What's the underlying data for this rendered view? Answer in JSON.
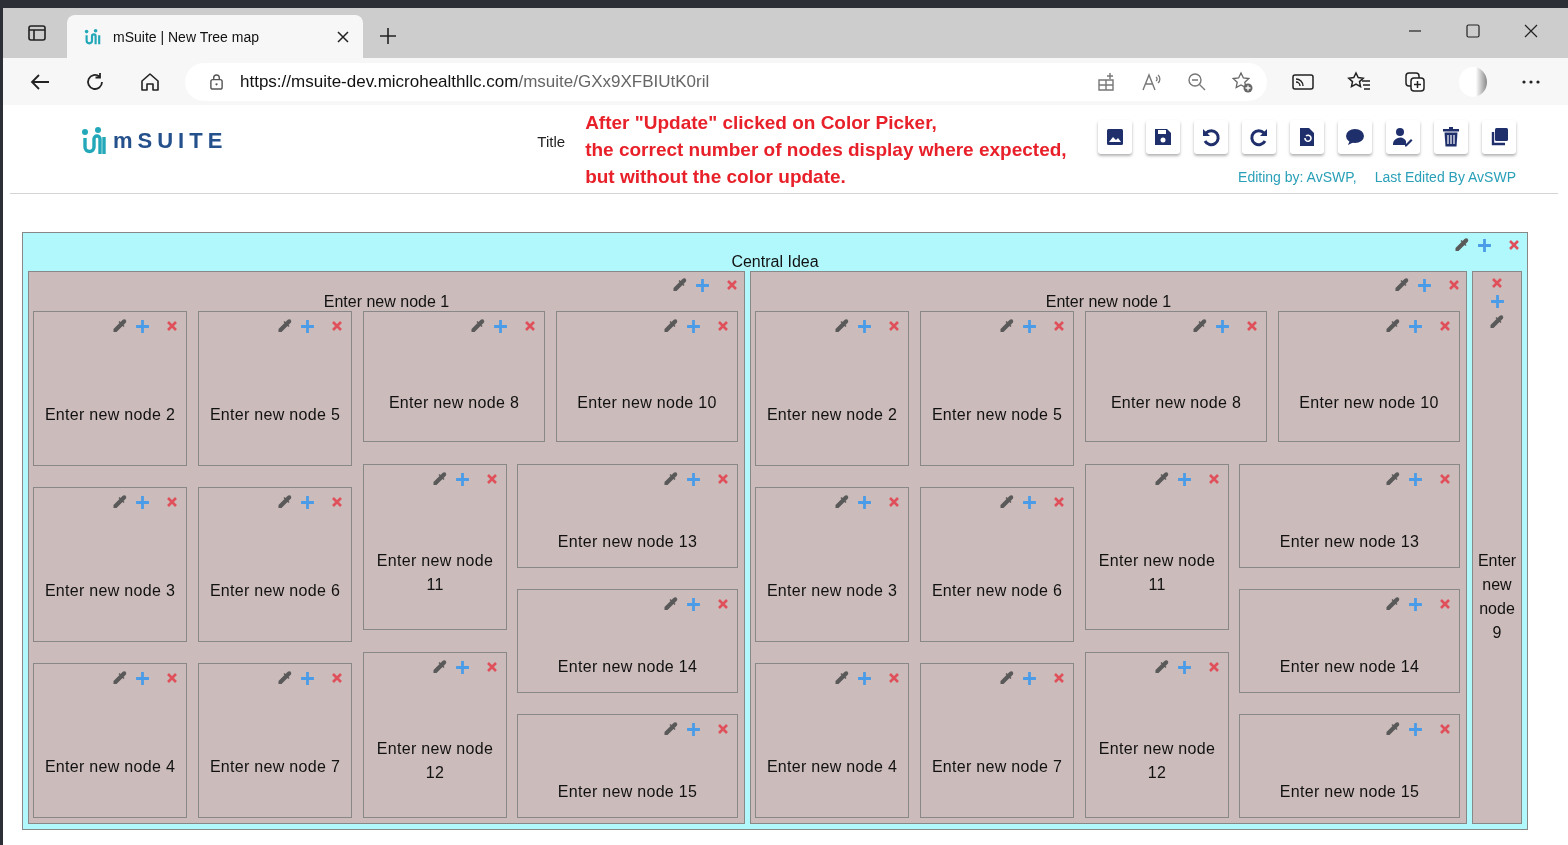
{
  "browser": {
    "tab_title": "mSuite | New Tree map",
    "url_host": "https://msuite-dev.microhealthllc.com",
    "url_path": "/msuite/GXx9XFBIUtK0ril"
  },
  "header": {
    "logo_text": "mSUITE",
    "title_label": "Title",
    "note": [
      "After \"Update\" clicked on Color Picker,",
      "the correct number of nodes display where expected,",
      "but without the color update."
    ],
    "editing_by": "Editing by: AvSWP,",
    "last_edited": "Last Edited By AvSWP"
  },
  "map": {
    "root": {
      "label": "Central Idea",
      "color": "#b1f8fc",
      "children": [
        {
          "kind": "panel",
          "label": "Enter new node 1",
          "color": "#cbbbba",
          "children": [
            {
              "label": "Enter new node 2",
              "color": "#cbbbba"
            },
            {
              "label": "Enter new node 3",
              "color": "#cbbbba"
            },
            {
              "label": "Enter new node 4",
              "color": "#cbbbba"
            },
            {
              "label": "Enter new node 5",
              "color": "#cbbbba"
            },
            {
              "label": "Enter new node 6",
              "color": "#cbbbba"
            },
            {
              "label": "Enter new node 7",
              "color": "#cbbbba"
            },
            {
              "label": "Enter new node 8",
              "color": "#cbbbba"
            },
            {
              "label": "Enter new node 10",
              "color": "#cbbbba"
            },
            {
              "label": "Enter new node 11",
              "color": "#cbbbba"
            },
            {
              "label": "Enter new node 12",
              "color": "#cbbbba"
            },
            {
              "label": "Enter new node 13",
              "color": "#cbbbba"
            },
            {
              "label": "Enter new node 14",
              "color": "#cbbbba"
            },
            {
              "label": "Enter new node 15",
              "color": "#cbbbba"
            }
          ]
        },
        {
          "kind": "panel",
          "label": "Enter new node 1",
          "color": "#cbbbba",
          "children": [
            {
              "label": "Enter new node 2",
              "color": "#cbbbba"
            },
            {
              "label": "Enter new node 3",
              "color": "#cbbbba"
            },
            {
              "label": "Enter new node 4",
              "color": "#cbbbba"
            },
            {
              "label": "Enter new node 5",
              "color": "#cbbbba"
            },
            {
              "label": "Enter new node 6",
              "color": "#cbbbba"
            },
            {
              "label": "Enter new node 7",
              "color": "#cbbbba"
            },
            {
              "label": "Enter new node 8",
              "color": "#cbbbba"
            },
            {
              "label": "Enter new node 10",
              "color": "#cbbbba"
            },
            {
              "label": "Enter new node 11",
              "color": "#cbbbba"
            },
            {
              "label": "Enter new node 12",
              "color": "#cbbbba"
            },
            {
              "label": "Enter new node 13",
              "color": "#cbbbba"
            },
            {
              "label": "Enter new node 14",
              "color": "#cbbbba"
            },
            {
              "label": "Enter new node 15",
              "color": "#cbbbba"
            }
          ]
        },
        {
          "kind": "strip",
          "label": "Enter new node 9",
          "color": "#cbbbba"
        }
      ]
    }
  }
}
